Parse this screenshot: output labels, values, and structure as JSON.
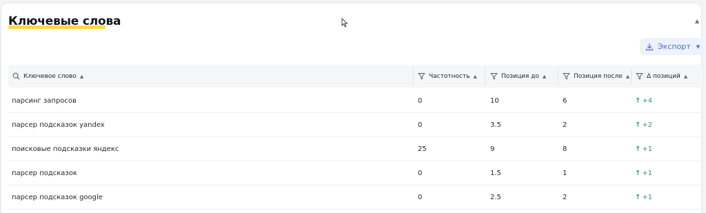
{
  "section": {
    "title": "Ключевые слова"
  },
  "toolbar": {
    "export_label": "Экспорт"
  },
  "colors": {
    "accent": "#4a6fd3",
    "highlight": "#ffd84a",
    "positive": "#2e9e5b"
  },
  "table": {
    "columns": [
      {
        "label": "Ключевое слово",
        "icon": "search-icon"
      },
      {
        "label": "Частотность",
        "icon": "filter-icon"
      },
      {
        "label": "Позиция до",
        "icon": "filter-icon"
      },
      {
        "label": "Позиция после",
        "icon": "filter-icon"
      },
      {
        "label": "Δ позиций",
        "icon": "filter-icon"
      }
    ],
    "rows": [
      {
        "keyword": "парсинг запросов",
        "frequency": "0",
        "pos_before": "10",
        "pos_after": "6",
        "delta": "+4"
      },
      {
        "keyword": "парсер подсказок yandex",
        "frequency": "0",
        "pos_before": "3.5",
        "pos_after": "2",
        "delta": "+2"
      },
      {
        "keyword": "поисковые подсказки яндекс",
        "frequency": "25",
        "pos_before": "9",
        "pos_after": "8",
        "delta": "+1"
      },
      {
        "keyword": "парсер подсказок",
        "frequency": "0",
        "pos_before": "1.5",
        "pos_after": "1",
        "delta": "+1"
      },
      {
        "keyword": "парсер подсказок google",
        "frequency": "0",
        "pos_before": "2.5",
        "pos_after": "2",
        "delta": "+1"
      }
    ]
  }
}
